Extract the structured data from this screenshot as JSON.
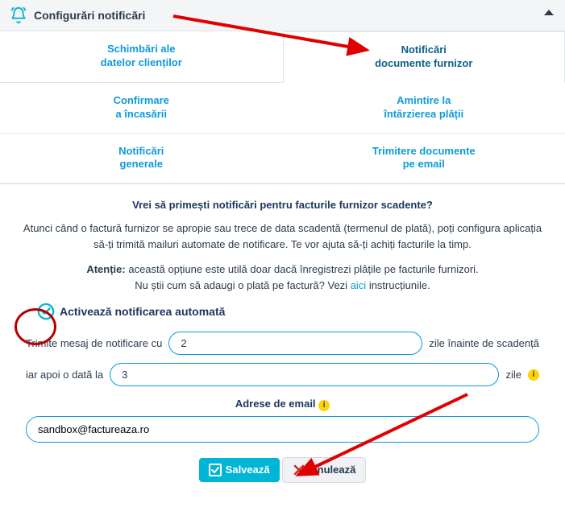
{
  "header": {
    "title": "Configurări notificări"
  },
  "tabs": [
    {
      "line1": "Schimbări ale",
      "line2": "datelor clienților",
      "active": false
    },
    {
      "line1": "Notificări",
      "line2": "documente furnizor",
      "active": true
    },
    {
      "line1": "Confirmare",
      "line2": "a încasării",
      "active": false
    },
    {
      "line1": "Amintire la",
      "line2": "întârzierea plății",
      "active": false
    },
    {
      "line1": "Notificări",
      "line2": "generale",
      "active": false
    },
    {
      "line1": "Trimitere documente",
      "line2": "pe email",
      "active": false
    }
  ],
  "texts": {
    "question": "Vrei să primești notificări pentru facturile furnizor scadente?",
    "para1": "Atunci când o factură furnizor se apropie sau trece de data scadentă (termenul de plată), poți configura aplicația să-ți trimită mailuri automate de notificare. Te vor ajuta să-ți achiți facturile la timp.",
    "attention_label": "Atenție:",
    "attention_text": " această opțiune este utilă doar dacă înregistrezi plățile pe facturile furnizori.",
    "help_pre": "Nu știi cum să adaugi o plată pe factură? Vezi ",
    "help_link": "aici",
    "help_post": " instrucțiunile.",
    "activate": "Activează notificarea automată",
    "row1_left": "Trimite mesaj de notificare cu",
    "row1_right": "zile înainte de scadență",
    "row2_left": "iar apoi o dată la",
    "row2_right": "zile",
    "email_heading": "Adrese de email",
    "info_glyph": "i"
  },
  "inputs": {
    "days_before": "2",
    "repeat_days": "3",
    "email": "sandbox@factureaza.ro"
  },
  "buttons": {
    "save": "Salvează",
    "cancel": "Anulează"
  }
}
